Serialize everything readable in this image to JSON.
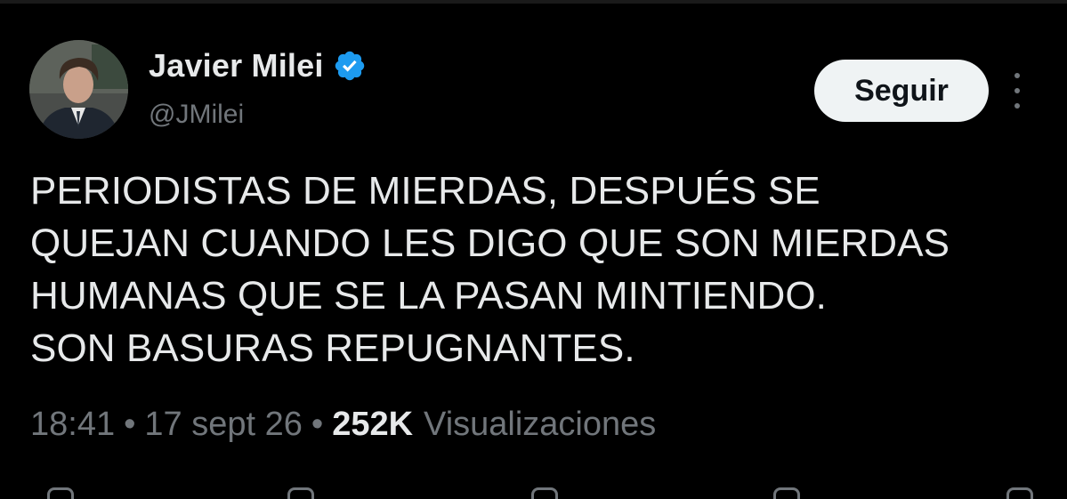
{
  "author": {
    "name": "Javier Milei",
    "handle": "@JMilei",
    "verified_icon": "verified-badge-icon",
    "avatar_icon": "profile-photo"
  },
  "follow_button": {
    "label": "Seguir"
  },
  "more_menu_icon": "more-vertical-icon",
  "tweet": {
    "text": "PERIODISTAS DE MIERDAS, DESPUÉS SE\nQUEJAN CUANDO LES DIGO QUE SON MIERDAS\nHUMANAS QUE SE LA PASAN MINTIENDO.\nSON BASURAS REPUGNANTES."
  },
  "meta": {
    "time": "18:41",
    "separator": "•",
    "date": "17 sept 26",
    "views_count": "252K",
    "views_label": "Visualizaciones"
  },
  "actions": [
    {
      "icon": "reply-icon"
    },
    {
      "icon": "retweet-icon"
    },
    {
      "icon": "like-icon"
    },
    {
      "icon": "bookmark-icon"
    },
    {
      "icon": "share-icon"
    }
  ],
  "colors": {
    "background": "#000000",
    "primary_text": "#e7e9ea",
    "secondary_text": "#71767b",
    "verified_blue": "#1d9bf0",
    "button_bg": "#eff3f4",
    "button_text": "#0f1419"
  }
}
